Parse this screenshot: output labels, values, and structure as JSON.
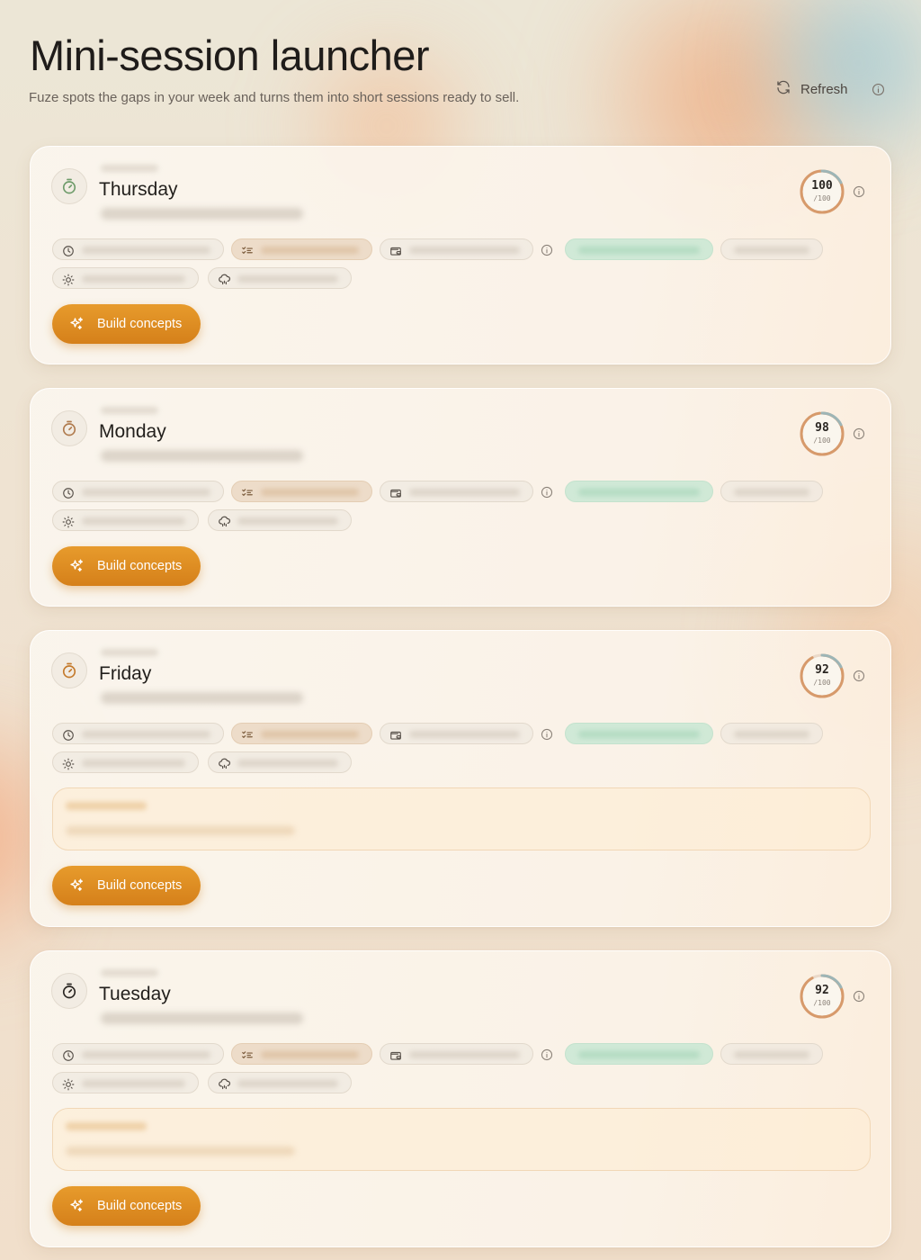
{
  "header": {
    "title": "Mini-session launcher",
    "subtitle": "Fuze spots the gaps in your week and turns them into short sessions ready to sell.",
    "refresh_label": "Refresh",
    "refresh_icon": "refresh-icon",
    "info_icon": "info-icon"
  },
  "colors": {
    "accent": "#df8d24",
    "score_ring": "#d79a6b",
    "score_ring_secondary": "#8fbcc9",
    "chip_green": "#c8e8d4",
    "note_bg": "#fdecd4"
  },
  "cards": [
    {
      "day": "Thursday",
      "day_icon": "timer-icon",
      "score": "100",
      "score_max": "/100",
      "score_value": 100,
      "build_label": "Build concepts",
      "has_note": false
    },
    {
      "day": "Monday",
      "day_icon": "timer-icon",
      "score": "98",
      "score_max": "/100",
      "score_value": 98,
      "build_label": "Build concepts",
      "has_note": false
    },
    {
      "day": "Friday",
      "day_icon": "timer-icon",
      "score": "92",
      "score_max": "/100",
      "score_value": 92,
      "build_label": "Build concepts",
      "has_note": true
    },
    {
      "day": "Tuesday",
      "day_icon": "timer-icon",
      "score": "92",
      "score_max": "/100",
      "score_value": 92,
      "build_label": "Build concepts",
      "has_note": true
    }
  ]
}
